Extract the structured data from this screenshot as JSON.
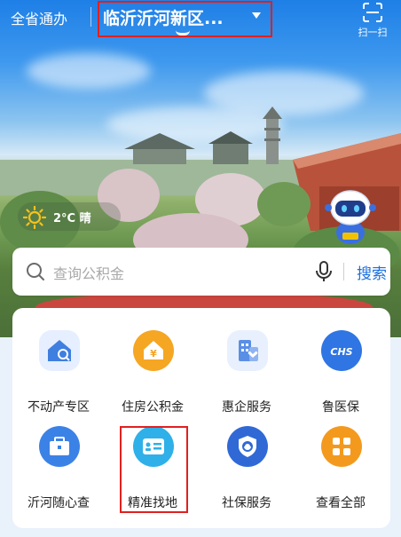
{
  "header": {
    "province_label": "全省通办",
    "city_label": "临沂沂河新区...",
    "scan_label": "扫一扫"
  },
  "weather": {
    "temperature": "2°C",
    "condition": "晴",
    "icon": "sun-icon"
  },
  "search": {
    "placeholder": "查询公积金",
    "button_label": "搜索"
  },
  "services": [
    {
      "label": "不动产专区",
      "icon": "house-search-icon",
      "color": "#3f7fe0"
    },
    {
      "label": "住房公积金",
      "icon": "house-yen-icon",
      "color": "#f5a623"
    },
    {
      "label": "惠企服务",
      "icon": "building-heart-icon",
      "color": "#5a8fe6"
    },
    {
      "label": "鲁医保",
      "icon": "chs-shield-icon",
      "color": "#2f75e3"
    },
    {
      "label": "沂河随心查",
      "icon": "toolbox-icon",
      "color": "#3b82e6"
    },
    {
      "label": "精准找地",
      "icon": "id-card-icon",
      "color": "#2fb0e8"
    },
    {
      "label": "社保服务",
      "icon": "social-security-icon",
      "color": "#3069d6"
    },
    {
      "label": "查看全部",
      "icon": "grid-icon",
      "color": "#f39a1e"
    }
  ]
}
